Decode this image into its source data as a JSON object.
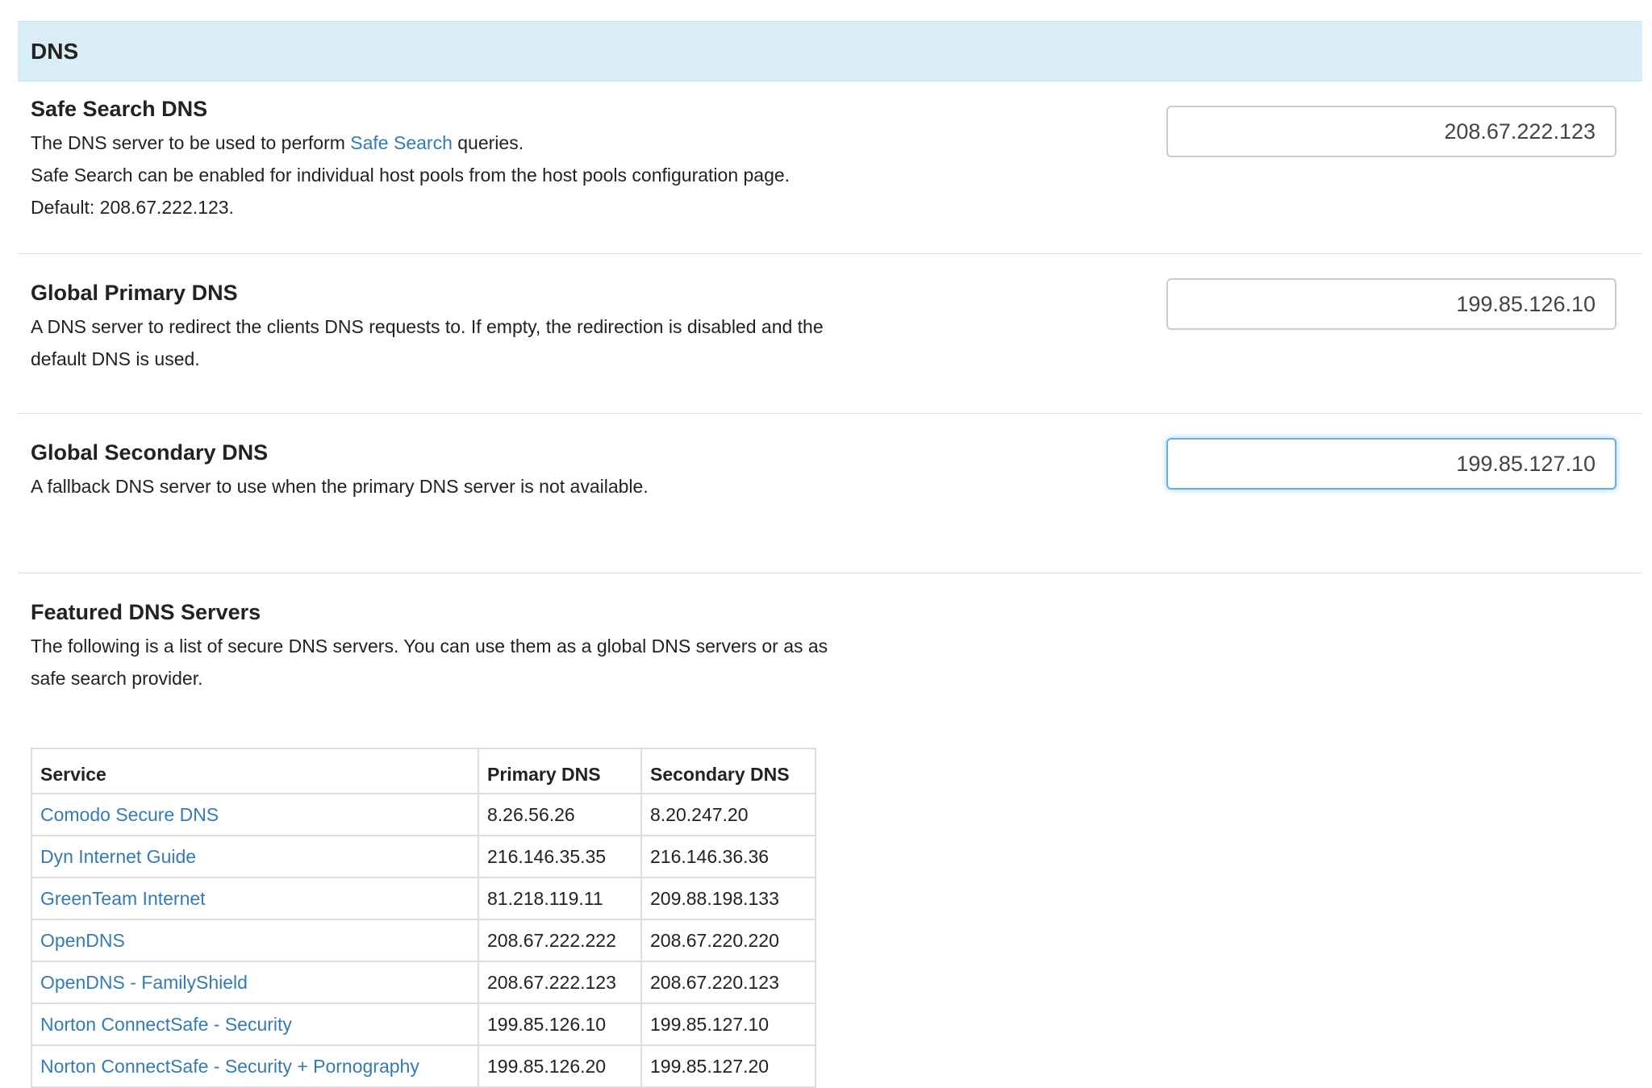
{
  "section": {
    "title": "DNS"
  },
  "safe_search": {
    "title": "Safe Search DNS",
    "desc_prefix": "The DNS server to be used to perform ",
    "desc_link": "Safe Search",
    "desc_suffix": " queries.",
    "desc_line2": "Safe Search can be enabled for individual host pools from the host pools configuration page. Default: 208.67.222.123.",
    "value": "208.67.222.123"
  },
  "global_primary": {
    "title": "Global Primary DNS",
    "desc": "A DNS server to redirect the clients DNS requests to. If empty, the redirection is disabled and the default DNS is used.",
    "value": "199.85.126.10"
  },
  "global_secondary": {
    "title": "Global Secondary DNS",
    "desc": "A fallback DNS server to use when the primary DNS server is not available.",
    "value": "199.85.127.10"
  },
  "featured": {
    "title": "Featured DNS Servers",
    "desc": "The following is a list of secure DNS servers. You can use them as a global DNS servers or as as safe search provider.",
    "columns": [
      "Service",
      "Primary DNS",
      "Secondary DNS"
    ],
    "rows": [
      {
        "service": "Comodo Secure DNS",
        "primary": "8.26.56.26",
        "secondary": "8.20.247.20"
      },
      {
        "service": "Dyn Internet Guide",
        "primary": "216.146.35.35",
        "secondary": "216.146.36.36"
      },
      {
        "service": "GreenTeam Internet",
        "primary": "81.218.119.11",
        "secondary": "209.88.198.133"
      },
      {
        "service": "OpenDNS",
        "primary": "208.67.222.222",
        "secondary": "208.67.220.220"
      },
      {
        "service": "OpenDNS - FamilyShield",
        "primary": "208.67.222.123",
        "secondary": "208.67.220.123"
      },
      {
        "service": "Norton ConnectSafe - Security",
        "primary": "199.85.126.10",
        "secondary": "199.85.127.10"
      },
      {
        "service": "Norton ConnectSafe - Security + Pornography",
        "primary": "199.85.126.20",
        "secondary": "199.85.127.20"
      }
    ]
  },
  "colors": {
    "heading_bg": "#d9edf7",
    "link": "#337ab7",
    "focus_border": "#66afe9"
  }
}
